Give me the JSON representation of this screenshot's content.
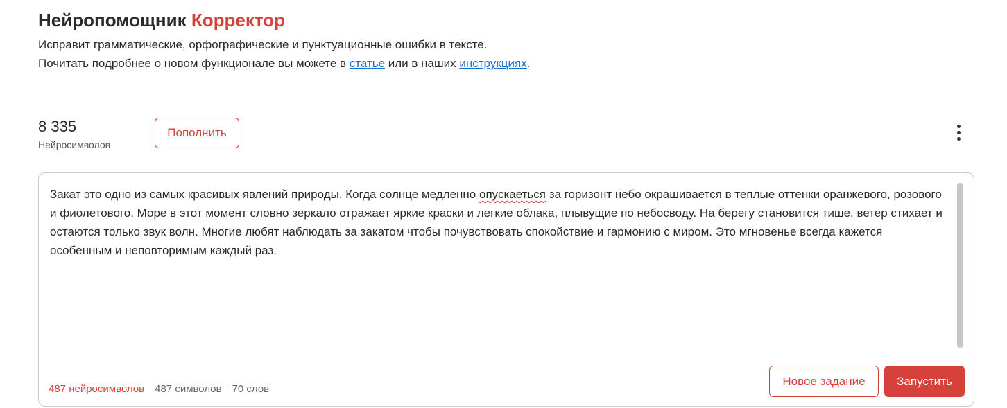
{
  "header": {
    "title_main": "Нейропомощник",
    "title_accent": "Корректор",
    "description_line1": "Исправит грамматические, орфографические и пунктуационные ошибки в тексте.",
    "description_line2_before": "Почитать подробнее о новом функционале вы можете в ",
    "link_article": "статье",
    "description_line2_middle": " или в наших ",
    "link_instructions": "инструкциях",
    "description_line2_after": "."
  },
  "balance": {
    "value": "8 335",
    "label": "Нейросимволов",
    "topup_label": "Пополнить"
  },
  "menu": {
    "icon": "more-vertical-icon"
  },
  "editor": {
    "text_before": "Закат это одно из самых красивых явлений природы. Когда солнце медленно ",
    "misspelled_word": "опускаеться",
    "text_after": " за горизонт небо окрашивается в теплые оттенки оранжевого, розового и фиолетового. Море в этот момент словно зеркало отражает яркие краски и легкие облака, плывущие по небосводу. На берегу становится тише, ветер стихает и остаются только звук волн. Многие любят наблюдать за закатом чтобы почувствовать спокойствие и гармонию с миром. Это мгновенье всегда кажется особенным и неповторимым каждый раз."
  },
  "stats": {
    "neuro_symbols": "487 нейросимволов",
    "symbols": "487 символов",
    "words": "70 слов"
  },
  "actions": {
    "new_task_label": "Новое задание",
    "run_label": "Запустить"
  },
  "colors": {
    "accent": "#d6423a",
    "link": "#1a6fd1",
    "text": "#2b2b2b",
    "border": "#c9c9c9"
  }
}
